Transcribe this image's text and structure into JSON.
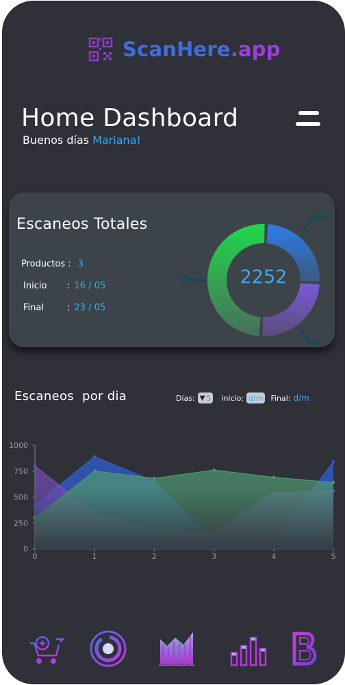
{
  "app": {
    "logo_name": "ScanHere",
    "logo_ext": ".app"
  },
  "header": {
    "title": "Home Dashboard",
    "greeting": "Buenos días",
    "user": "Mariana!"
  },
  "card": {
    "title": "Escaneos Totales",
    "total": "2252",
    "stats": [
      {
        "label": "Productos",
        "sep": " : ",
        "value": "3"
      },
      {
        "label": "Inicio",
        "sep": ": ",
        "value": "16 / 05"
      },
      {
        "label": "Final",
        "sep": ": ",
        "value": "23 / 05"
      }
    ]
  },
  "chart_section": {
    "title": "Escaneos  por dia",
    "filters": {
      "dias_label": "Dias:",
      "dias_value": "5",
      "inicio_label": "inicio:",
      "inicio_value": "d/m",
      "final_label": "Final:",
      "final_value": "d/m"
    }
  },
  "chart_data": {
    "type": "area",
    "x": [
      0,
      1,
      2,
      3,
      4,
      5
    ],
    "xlim": [
      0,
      5
    ],
    "ylim": [
      0,
      1000
    ],
    "yticks": [
      0,
      250,
      500,
      750,
      1000
    ],
    "series": [
      {
        "values": [
          420,
          890,
          650,
          80,
          65,
          840
        ],
        "color": "#2f5fd0"
      },
      {
        "values": [
          300,
          750,
          680,
          760,
          690,
          640
        ],
        "color": "#4e9a72"
      },
      {
        "values": [
          800,
          340,
          190,
          150,
          540,
          560
        ],
        "color": "#7c4fc0"
      }
    ]
  },
  "donut_data": {
    "segments": [
      {
        "value": 50,
        "color": "#22c640"
      },
      {
        "value": 25,
        "color": "#2f7ee8"
      },
      {
        "value": 25,
        "color": "#7a56d6"
      }
    ]
  },
  "nav": {
    "items": [
      "cart",
      "scan-target",
      "line-chart",
      "bar-chart",
      "brand"
    ]
  },
  "colors": {
    "background": "#303039",
    "card": "#3d4449",
    "accent_blue": "#3fa8f0",
    "brand_blue": "#3f6de0",
    "brand_purple": "#9b3de0"
  }
}
